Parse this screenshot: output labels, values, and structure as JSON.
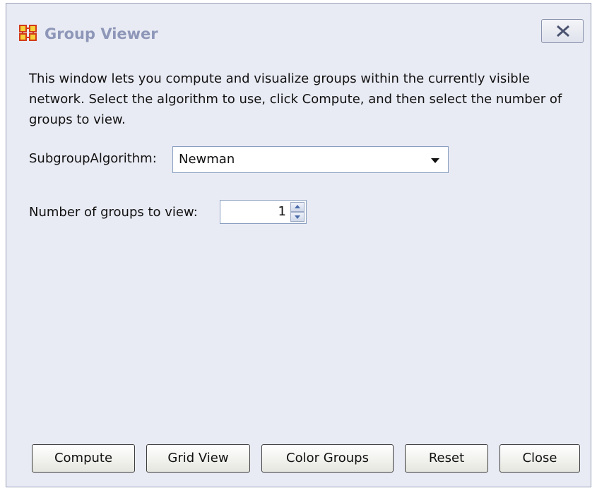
{
  "window": {
    "title": "Group Viewer",
    "icon": "network-grid-icon",
    "close_icon": "close-x-icon"
  },
  "description": "This window lets you compute and visualize groups within the currently visible network. Select the algorithm to use, click Compute, and then select the number of groups to view.",
  "algorithm": {
    "label": "SubgroupAlgorithm:",
    "value": "Newman"
  },
  "groups": {
    "label": "Number of groups to view:",
    "value": "1"
  },
  "buttons": {
    "compute": "Compute",
    "grid_view": "Grid View",
    "color_groups": "Color Groups",
    "reset": "Reset",
    "close": "Close"
  },
  "colors": {
    "window_bg": "#e9ebf4",
    "title_text": "#8e97b8",
    "icon_accent": "#d23a1a"
  }
}
